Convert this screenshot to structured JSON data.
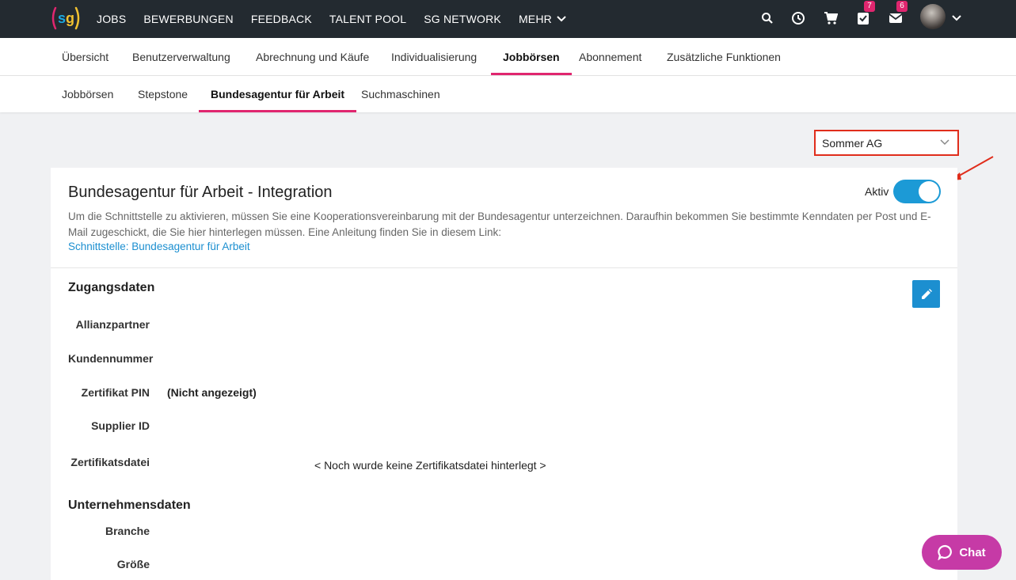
{
  "topbar": {
    "logo_text": "sg",
    "nav": [
      {
        "label": "JOBS"
      },
      {
        "label": "BEWERBUNGEN"
      },
      {
        "label": "FEEDBACK"
      },
      {
        "label": "TALENT POOL"
      },
      {
        "label": "SG NETWORK"
      },
      {
        "label": "MEHR"
      }
    ],
    "tasks_badge": "7",
    "mail_badge": "6"
  },
  "nav1": {
    "tabs": [
      {
        "label": "Übersicht"
      },
      {
        "label": "Benutzerverwaltung"
      },
      {
        "label": "Abrechnung und Käufe"
      },
      {
        "label": "Individualisierung"
      },
      {
        "label": "Jobbörsen"
      },
      {
        "label": "Abonnement"
      },
      {
        "label": "Zusätzliche Funktionen"
      }
    ],
    "active_index": 4
  },
  "nav2": {
    "tabs": [
      {
        "label": "Jobbörsen"
      },
      {
        "label": "Stepstone"
      },
      {
        "label": "Bundesagentur für Arbeit"
      },
      {
        "label": "Suchmaschinen"
      }
    ],
    "active_index": 2
  },
  "company_select": {
    "value": "Sommer AG"
  },
  "card": {
    "title": "Bundesagentur für Arbeit - Integration",
    "toggle_label": "Aktiv",
    "toggle_on": true,
    "description": "Um die Schnittstelle zu aktivieren, müssen Sie eine Kooperationsvereinbarung mit der Bundesagentur unterzeichnen. Daraufhin bekommen Sie bestimmte Kenndaten per Post und E-Mail zugeschickt, die Sie hier hinterlegen müssen. Eine Anleitung finden Sie in diesem Link:",
    "link": "Schnittstelle: Bundesagentur für Arbeit"
  },
  "access": {
    "title": "Zugangsdaten",
    "fields": [
      {
        "label": "Allianzpartner",
        "value": ""
      },
      {
        "label": "Kundennummer",
        "value": ""
      },
      {
        "label": "Zertifikat PIN",
        "value": "(Nicht angezeigt)"
      },
      {
        "label": "Supplier ID",
        "value": ""
      },
      {
        "label": "Zertifikatsdatei",
        "value": "< Noch wurde keine Zertifikatsdatei hinterlegt >"
      }
    ]
  },
  "company": {
    "title": "Unternehmensdaten",
    "fields": [
      {
        "label": "Branche",
        "value": ""
      },
      {
        "label": "Größe",
        "value": ""
      }
    ]
  },
  "chat": {
    "label": "Chat"
  },
  "colors": {
    "topbar": "#232a30",
    "accent_pink": "#e0266f",
    "primary_blue": "#1c8fd0",
    "highlight_red": "#e02d1b",
    "chat_purple": "#c63aa6"
  },
  "icons": [
    "search-icon",
    "clock-icon",
    "cart-icon",
    "tasks-icon",
    "mail-icon",
    "chevron-down-icon",
    "pencil-icon",
    "chat-bubble-icon"
  ]
}
